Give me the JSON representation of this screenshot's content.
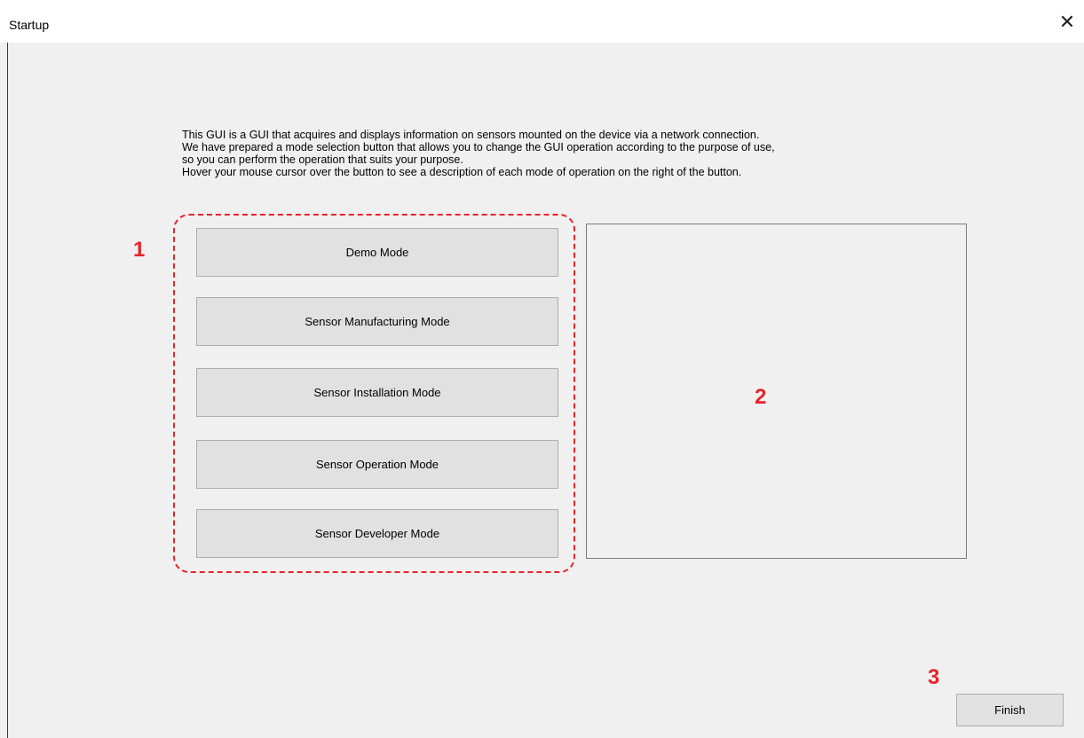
{
  "window": {
    "title": "Startup",
    "close_glyph": "✕"
  },
  "description": {
    "lines": [
      "This GUI is a GUI that acquires and displays information on sensors mounted on the device via a network connection.",
      "We have prepared a mode selection button that allows you to change the GUI operation according to the purpose of use,",
      "so you can perform the operation that suits your purpose.",
      "Hover your mouse cursor over the button to see a description of each mode of operation on the right of the button."
    ]
  },
  "modes": [
    {
      "label": "Demo Mode"
    },
    {
      "label": "Sensor Manufacturing Mode"
    },
    {
      "label": "Sensor Installation Mode"
    },
    {
      "label": "Sensor Operation Mode"
    },
    {
      "label": "Sensor Developer Mode"
    }
  ],
  "callouts": {
    "one": "1",
    "two": "2",
    "three": "3"
  },
  "footer": {
    "finish_label": "Finish"
  },
  "colors": {
    "callout": "#e8232a",
    "window_bg": "#f0f0f0",
    "button_bg": "#e1e1e1"
  }
}
